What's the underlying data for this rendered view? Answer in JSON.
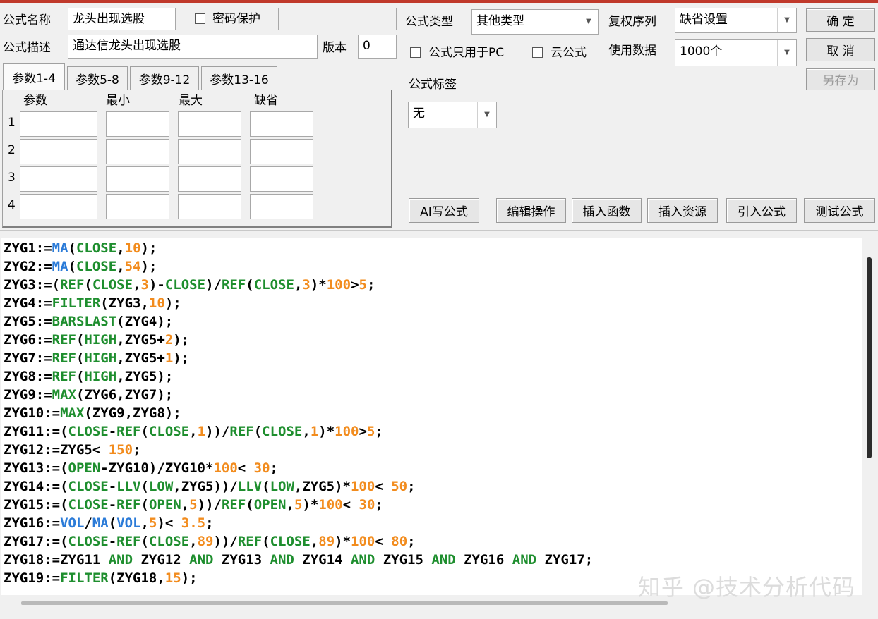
{
  "form": {
    "name_label": "公式名称",
    "name_value": "龙头出现选股",
    "password_label": "密码保护",
    "desc_label": "公式描述",
    "desc_value": "通达信龙头出现选股",
    "version_label": "版本",
    "version_value": "0",
    "type_label": "公式类型",
    "type_value": "其他类型",
    "pc_only_label": "公式只用于PC",
    "cloud_label": "云公式",
    "fq_label": "复权序列",
    "fq_value": "缺省设置",
    "data_label": "使用数据",
    "data_value": "1000个",
    "tag_label": "公式标签",
    "tag_value": "无"
  },
  "buttons": {
    "ok": "确  定",
    "cancel": "取  消",
    "save_as": "另存为",
    "ai": "AI写公式",
    "edit": "编辑操作",
    "insert_func": "插入函数",
    "insert_res": "插入资源",
    "import": "引入公式",
    "test": "测试公式"
  },
  "tabs": [
    "参数1-4",
    "参数5-8",
    "参数9-12",
    "参数13-16"
  ],
  "params": {
    "headers": [
      "参数",
      "最小",
      "最大",
      "缺省"
    ],
    "rows": [
      "1",
      "2",
      "3",
      "4"
    ]
  },
  "code_lines": [
    [
      [
        "ZYG1:=",
        ""
      ],
      [
        "MA",
        "b"
      ],
      [
        "(",
        ""
      ],
      [
        "CLOSE",
        "f"
      ],
      [
        ",",
        ""
      ],
      [
        "10",
        "n"
      ],
      [
        ");",
        ""
      ]
    ],
    [
      [
        "ZYG2:=",
        ""
      ],
      [
        "MA",
        "b"
      ],
      [
        "(",
        ""
      ],
      [
        "CLOSE",
        "f"
      ],
      [
        ",",
        ""
      ],
      [
        "54",
        "n"
      ],
      [
        ");",
        ""
      ]
    ],
    [
      [
        "ZYG3:=(",
        ""
      ],
      [
        "REF",
        "f"
      ],
      [
        "(",
        ""
      ],
      [
        "CLOSE",
        "f"
      ],
      [
        ",",
        ""
      ],
      [
        "3",
        "n"
      ],
      [
        ")-",
        ""
      ],
      [
        "CLOSE",
        "f"
      ],
      [
        ")/",
        ""
      ],
      [
        "REF",
        "f"
      ],
      [
        "(",
        ""
      ],
      [
        "CLOSE",
        "f"
      ],
      [
        ",",
        ""
      ],
      [
        "3",
        "n"
      ],
      [
        ")*",
        ""
      ],
      [
        "100",
        "n"
      ],
      [
        ">",
        ""
      ],
      [
        "5",
        "n"
      ],
      [
        ";",
        ""
      ]
    ],
    [
      [
        "ZYG4:=",
        ""
      ],
      [
        "FILTER",
        "f"
      ],
      [
        "(ZYG3,",
        ""
      ],
      [
        "10",
        "n"
      ],
      [
        ");",
        ""
      ]
    ],
    [
      [
        "ZYG5:=",
        ""
      ],
      [
        "BARSLAST",
        "f"
      ],
      [
        "(ZYG4);",
        ""
      ]
    ],
    [
      [
        "ZYG6:=",
        ""
      ],
      [
        "REF",
        "f"
      ],
      [
        "(",
        ""
      ],
      [
        "HIGH",
        "f"
      ],
      [
        ",ZYG5+",
        ""
      ],
      [
        "2",
        "n"
      ],
      [
        ");",
        ""
      ]
    ],
    [
      [
        "ZYG7:=",
        ""
      ],
      [
        "REF",
        "f"
      ],
      [
        "(",
        ""
      ],
      [
        "HIGH",
        "f"
      ],
      [
        ",ZYG5+",
        ""
      ],
      [
        "1",
        "n"
      ],
      [
        ");",
        ""
      ]
    ],
    [
      [
        "ZYG8:=",
        ""
      ],
      [
        "REF",
        "f"
      ],
      [
        "(",
        ""
      ],
      [
        "HIGH",
        "f"
      ],
      [
        ",ZYG5);",
        ""
      ]
    ],
    [
      [
        "ZYG9:=",
        ""
      ],
      [
        "MAX",
        "f"
      ],
      [
        "(ZYG6,ZYG7);",
        ""
      ]
    ],
    [
      [
        "ZYG10:=",
        ""
      ],
      [
        "MAX",
        "f"
      ],
      [
        "(ZYG9,ZYG8);",
        ""
      ]
    ],
    [
      [
        "ZYG11:=(",
        ""
      ],
      [
        "CLOSE",
        "f"
      ],
      [
        "-",
        ""
      ],
      [
        "REF",
        "f"
      ],
      [
        "(",
        ""
      ],
      [
        "CLOSE",
        "f"
      ],
      [
        ",",
        ""
      ],
      [
        "1",
        "n"
      ],
      [
        "))/",
        ""
      ],
      [
        "REF",
        "f"
      ],
      [
        "(",
        ""
      ],
      [
        "CLOSE",
        "f"
      ],
      [
        ",",
        ""
      ],
      [
        "1",
        "n"
      ],
      [
        ")*",
        ""
      ],
      [
        "100",
        "n"
      ],
      [
        ">",
        ""
      ],
      [
        "5",
        "n"
      ],
      [
        ";",
        ""
      ]
    ],
    [
      [
        "ZYG12:=ZYG5< ",
        ""
      ],
      [
        "150",
        "n"
      ],
      [
        ";",
        ""
      ]
    ],
    [
      [
        "ZYG13:=(",
        ""
      ],
      [
        "OPEN",
        "f"
      ],
      [
        "-ZYG10)/ZYG10*",
        ""
      ],
      [
        "100",
        "n"
      ],
      [
        "< ",
        ""
      ],
      [
        "30",
        "n"
      ],
      [
        ";",
        ""
      ]
    ],
    [
      [
        "ZYG14:=(",
        ""
      ],
      [
        "CLOSE",
        "f"
      ],
      [
        "-",
        ""
      ],
      [
        "LLV",
        "f"
      ],
      [
        "(",
        ""
      ],
      [
        "LOW",
        "f"
      ],
      [
        ",ZYG5))/",
        ""
      ],
      [
        "LLV",
        "f"
      ],
      [
        "(",
        ""
      ],
      [
        "LOW",
        "f"
      ],
      [
        ",ZYG5)*",
        ""
      ],
      [
        "100",
        "n"
      ],
      [
        "< ",
        ""
      ],
      [
        "50",
        "n"
      ],
      [
        ";",
        ""
      ]
    ],
    [
      [
        "ZYG15:=(",
        ""
      ],
      [
        "CLOSE",
        "f"
      ],
      [
        "-",
        ""
      ],
      [
        "REF",
        "f"
      ],
      [
        "(",
        ""
      ],
      [
        "OPEN",
        "f"
      ],
      [
        ",",
        ""
      ],
      [
        "5",
        "n"
      ],
      [
        "))/",
        ""
      ],
      [
        "REF",
        "f"
      ],
      [
        "(",
        ""
      ],
      [
        "OPEN",
        "f"
      ],
      [
        ",",
        ""
      ],
      [
        "5",
        "n"
      ],
      [
        ")*",
        ""
      ],
      [
        "100",
        "n"
      ],
      [
        "< ",
        ""
      ],
      [
        "30",
        "n"
      ],
      [
        ";",
        ""
      ]
    ],
    [
      [
        "ZYG16:=",
        ""
      ],
      [
        "VOL",
        "b"
      ],
      [
        "/",
        ""
      ],
      [
        "MA",
        "b"
      ],
      [
        "(",
        ""
      ],
      [
        "VOL",
        "b"
      ],
      [
        ",",
        ""
      ],
      [
        "5",
        "n"
      ],
      [
        ")< ",
        ""
      ],
      [
        "3.5",
        "n"
      ],
      [
        ";",
        ""
      ]
    ],
    [
      [
        "ZYG17:=(",
        ""
      ],
      [
        "CLOSE",
        "f"
      ],
      [
        "-",
        ""
      ],
      [
        "REF",
        "f"
      ],
      [
        "(",
        ""
      ],
      [
        "CLOSE",
        "f"
      ],
      [
        ",",
        ""
      ],
      [
        "89",
        "n"
      ],
      [
        "))/",
        ""
      ],
      [
        "REF",
        "f"
      ],
      [
        "(",
        ""
      ],
      [
        "CLOSE",
        "f"
      ],
      [
        ",",
        ""
      ],
      [
        "89",
        "n"
      ],
      [
        ")*",
        ""
      ],
      [
        "100",
        "n"
      ],
      [
        "< ",
        ""
      ],
      [
        "80",
        "n"
      ],
      [
        ";",
        ""
      ]
    ],
    [
      [
        "ZYG18:=ZYG11 ",
        ""
      ],
      [
        "AND",
        "f"
      ],
      [
        " ZYG12 ",
        ""
      ],
      [
        "AND",
        "f"
      ],
      [
        " ZYG13 ",
        ""
      ],
      [
        "AND",
        "f"
      ],
      [
        " ZYG14 ",
        ""
      ],
      [
        "AND",
        "f"
      ],
      [
        " ZYG15 ",
        ""
      ],
      [
        "AND",
        "f"
      ],
      [
        " ZYG16 ",
        ""
      ],
      [
        "AND",
        "f"
      ],
      [
        " ZYG17;",
        ""
      ]
    ],
    [
      [
        "ZYG19:=",
        ""
      ],
      [
        "FILTER",
        "f"
      ],
      [
        "(ZYG18,",
        ""
      ],
      [
        "15",
        "n"
      ],
      [
        ");",
        ""
      ]
    ]
  ],
  "watermark": "知乎 @技术分析代码"
}
